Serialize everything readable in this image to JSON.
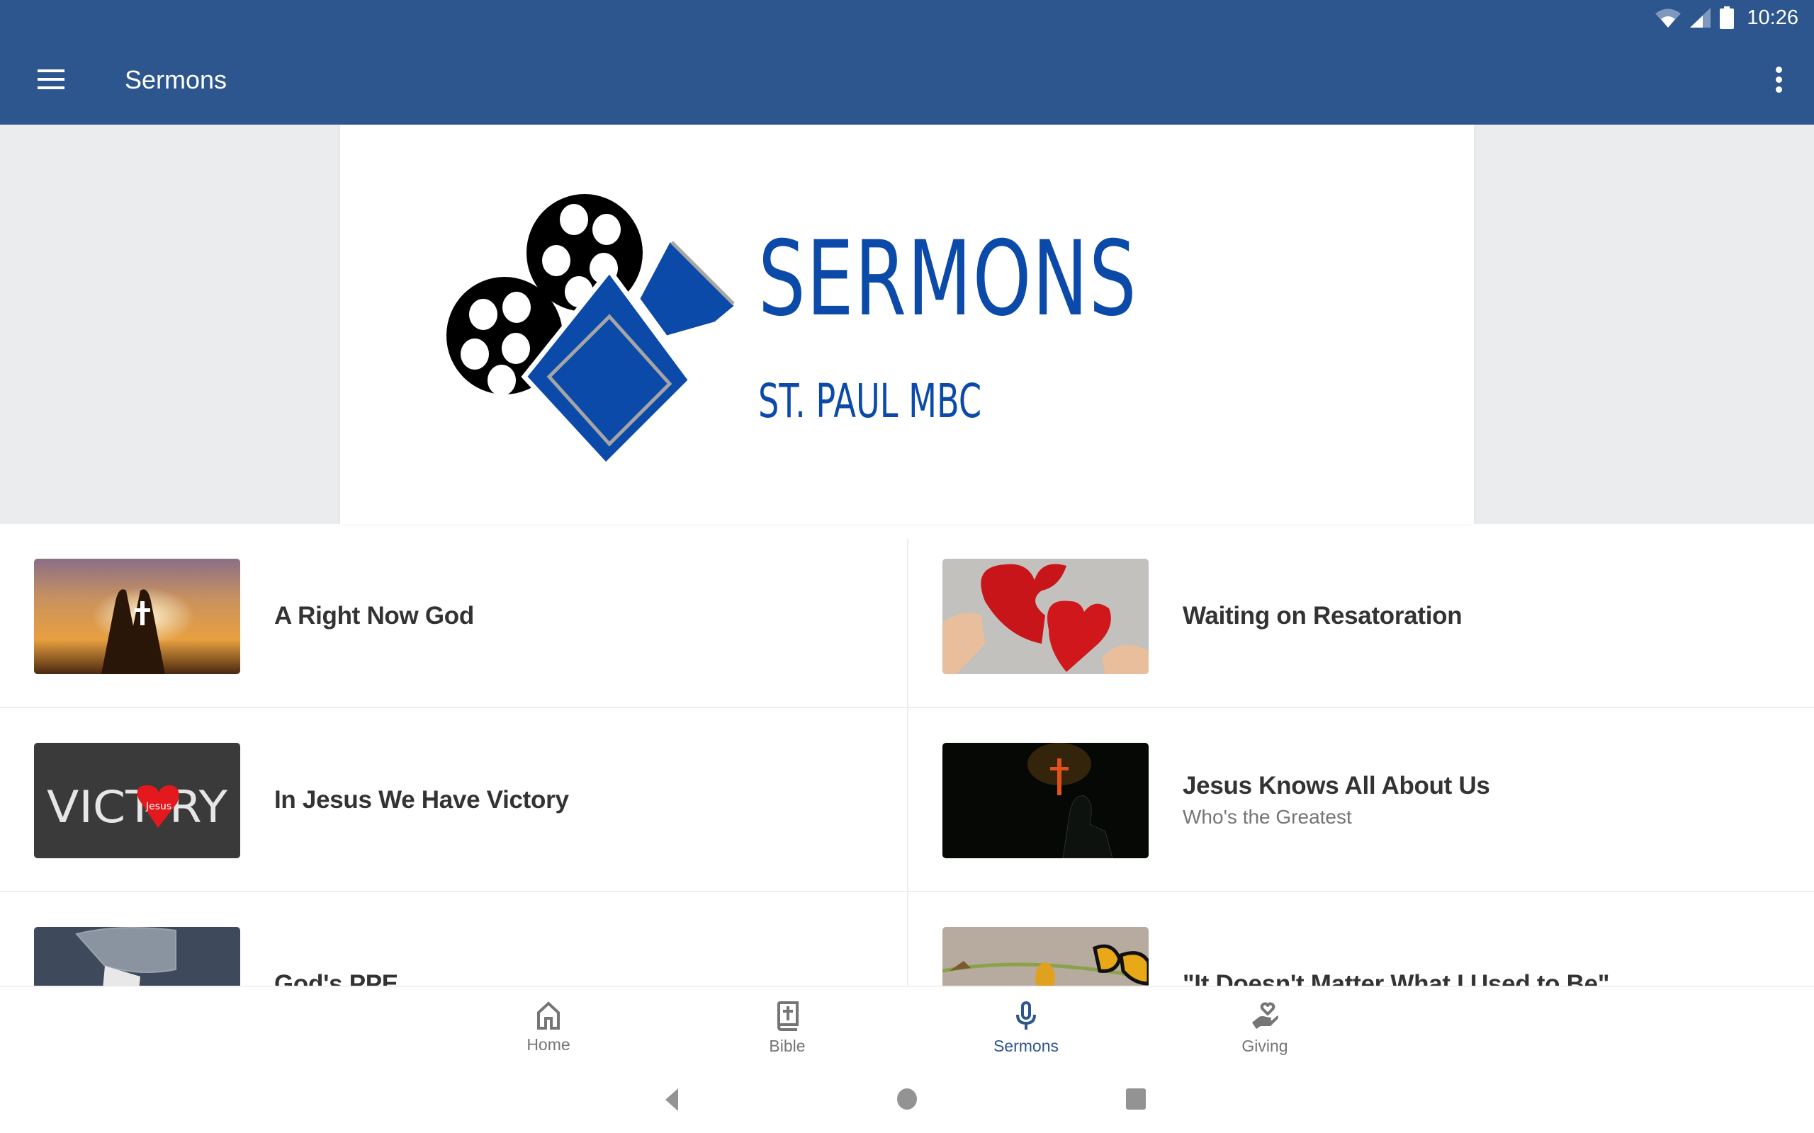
{
  "status_bar": {
    "time": "10:26",
    "icons": [
      "wifi-icon",
      "cell-signal-icon",
      "battery-icon"
    ]
  },
  "app_bar": {
    "title": "Sermons",
    "menu_icon": "hamburger-menu-icon",
    "overflow_icon": "more-vert-icon",
    "color": "#2D568F"
  },
  "banner": {
    "heading": "SERMONS",
    "subheading": "ST. PAUL MBC",
    "logo_icon": "film-camera-icon",
    "brand_color": "#0B4AA8"
  },
  "sermons": [
    {
      "title": "A Right Now God",
      "subtitle": "",
      "thumbnail": "praying-hands-sunset-cross"
    },
    {
      "title": "Waiting on Resatoration",
      "subtitle": "",
      "thumbnail": "red-hearts-hands"
    },
    {
      "title": "In Jesus We Have Victory",
      "subtitle": "",
      "thumbnail": "victory-chalkboard-heart"
    },
    {
      "title": "Jesus Knows All About Us",
      "subtitle": "Who's the Greatest",
      "thumbnail": "silhouette-red-cross"
    },
    {
      "title": "God's PPE",
      "subtitle": "",
      "thumbnail": "goggles-gloves-mask"
    },
    {
      "title": "\"It Doesn't Matter What I Used to Be\"",
      "subtitle": "",
      "thumbnail": "butterfly-caterpillar"
    }
  ],
  "bottom_nav": {
    "active": "Sermons",
    "active_color": "#2D568F",
    "items": [
      {
        "label": "Home",
        "icon": "home-icon"
      },
      {
        "label": "Bible",
        "icon": "bible-icon"
      },
      {
        "label": "Sermons",
        "icon": "microphone-icon"
      },
      {
        "label": "Giving",
        "icon": "hand-heart-icon"
      }
    ]
  },
  "system_nav": {
    "buttons": [
      "back-icon",
      "home-circle-icon",
      "recents-square-icon"
    ]
  }
}
